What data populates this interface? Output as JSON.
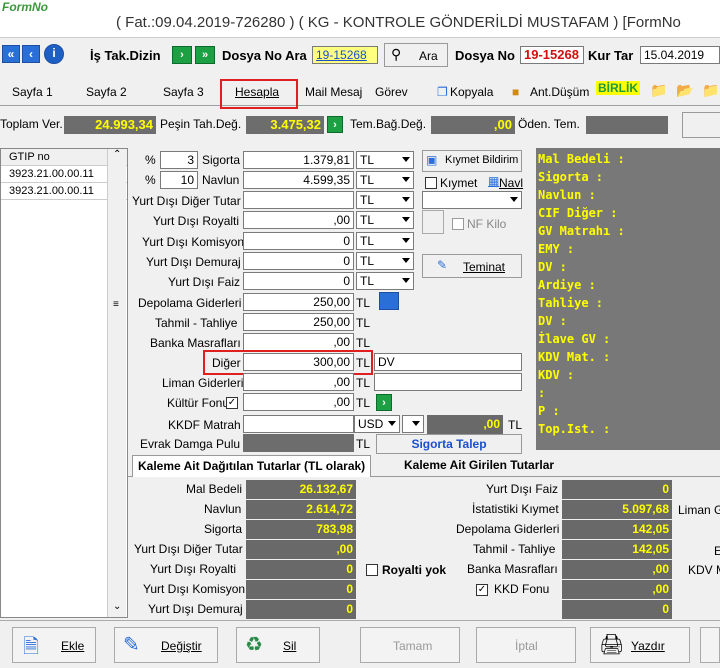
{
  "window": {
    "logo": "FormNo",
    "title": "( Fat.:09.04.2019-726280 ) ( KG  - KONTROLE GÖNDERİLDİ MUSTAFAM ) [FormNo"
  },
  "toolbar": {
    "is_tak_dizin": "İş Tak.Dizin",
    "dosya_no_ara_label": "Dosya No Ara",
    "dosya_no_ara_value": "19-15268",
    "ara_btn": "Ara",
    "dosya_no_label": "Dosya No",
    "dosya_no_value": "19-15268",
    "kur_tar_label": "Kur Tar",
    "kur_tar_value": "15.04.2019"
  },
  "tabs": [
    "Sayfa 1",
    "Sayfa 2",
    "Sayfa 3",
    "Hesapla",
    "Mail Mesaj",
    "Görev",
    "Kopyala",
    "Ant.Düşüm",
    "BİRLİK"
  ],
  "summary": {
    "toplam_ver_label": "Toplam Ver.",
    "toplam_ver": "24.993,34",
    "pesin_label": "Peşin Tah.Değ.",
    "pesin": "3.475,32",
    "tem_bag_label": "Tem.Bağ.Değ.",
    "tem_bag": ",00",
    "oden_label": "Öden. Tem."
  },
  "grid": {
    "header": "GTIP no",
    "rows": [
      "3923.21.00.00.11",
      "3923.21.00.00.11"
    ]
  },
  "form": {
    "sigorta_pct": "3",
    "sigorta_label": "Sigorta",
    "sigorta": "1.379,81",
    "sigorta_cur": "TL",
    "navlun_pct": "10",
    "navlun_label": "Navlun",
    "navlun": "4.599,35",
    "navlun_cur": "TL",
    "pct_symbol": "%",
    "yd_diger_tutar": "Yurt Dışı Diğer Tutar",
    "yd_diger_cur": "TL",
    "yd_royalti": "Yurt Dışı Royalti",
    "yd_royalti_val": ",00",
    "yd_royalti_cur": "TL",
    "yd_komisyon": "Yurt Dışı Komisyon",
    "yd_komisyon_val": "0",
    "yd_komisyon_cur": "TL",
    "yd_demuraj": "Yurt Dışı Demuraj",
    "yd_demuraj_val": "0",
    "yd_demuraj_cur": "TL",
    "yd_faiz": "Yurt Dışı Faiz",
    "yd_faiz_val": "0",
    "yd_faiz_cur": "TL",
    "depolama": "Depolama Giderleri",
    "depolama_val": "250,00",
    "tl": "TL",
    "tahmil": "Tahmil - Tahliye",
    "tahmil_val": "250,00",
    "banka": "Banka Masrafları",
    "banka_val": ",00",
    "diger": "Diğer",
    "diger_val": "300,00",
    "diger_note": "DV",
    "liman": "Liman Giderleri",
    "liman_val": ",00",
    "kultur": "Kültür Fonu",
    "kultur_val": ",00",
    "kkdf": "KKDF Matrah",
    "kkdf_cur": "USD",
    "kkdf_val": ",00",
    "evrak": "Evrak Damga Pulu",
    "kiymet_bildirim": "Kıymet Bildirim",
    "kiymet": "Kıymet",
    "navl": "Navl",
    "nf_kilo": "NF Kilo",
    "teminat": "Teminat",
    "sigorta_talep": "Sigorta Talep"
  },
  "rpanel": [
    "Mal Bedeli :",
    "Sigorta    :",
    "Navlun     :",
    "CIF Diğer  :",
    "GV Matrahı :",
    "EMY        :",
    "DV         :",
    "Ardiye     :",
    "Tahliye    :",
    "DV         :",
    "İlave GV   :",
    "KDV Mat.   :",
    "KDV        :",
    "           :",
    "P          :",
    "Top.Ist.   :"
  ],
  "lowtabs": {
    "t1": "Kaleme Ait Dağıtılan Tutarlar (TL olarak)",
    "t2": "Kaleme Ait Girilen Tutarlar"
  },
  "low_left": [
    {
      "label": "Mal Bedeli",
      "value": "26.132,67"
    },
    {
      "label": "Navlun",
      "value": "2.614,72"
    },
    {
      "label": "Sigorta",
      "value": "783,98"
    },
    {
      "label": "Yurt Dışı Diğer Tutar",
      "value": ",00"
    },
    {
      "label": "Yurt Dışı Royalti",
      "value": "0"
    },
    {
      "label": "Yurt Dışı Komisyon",
      "value": "0"
    },
    {
      "label": "Yurt Dışı Demuraj",
      "value": "0"
    }
  ],
  "low_right": [
    {
      "label": "Yurt Dışı Faiz",
      "value": "0"
    },
    {
      "label": "İstatistiki Kıymet",
      "value": "5.097,68"
    },
    {
      "label": "Depolama Giderleri",
      "value": "142,05"
    },
    {
      "label": "Tahmil - Tahliye",
      "value": "142,05"
    },
    {
      "label": "Banka Masrafları",
      "value": ",00"
    },
    {
      "label": "KKD Fonu",
      "value": ",00"
    },
    {
      "label": "",
      "value": "0"
    }
  ],
  "low_far": {
    "liman": "Liman G",
    "e": "E",
    "kdv": "KDV M"
  },
  "royalti_yok": "Royalti yok",
  "bottom": {
    "ekle": "Ekle",
    "degistir": "Değiştir",
    "sil": "Sil",
    "tamam": "Tamam",
    "iptal": "İptal",
    "yazdir": "Yazdır"
  },
  "colors": {
    "accent_red": "#e02020",
    "dark_panel": "#696969",
    "value_yellow": "#ffff00"
  }
}
